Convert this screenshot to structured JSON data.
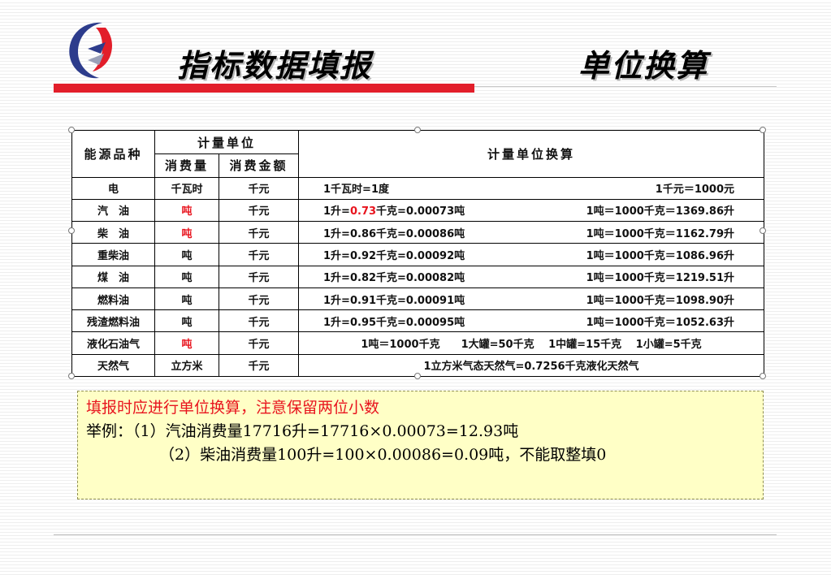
{
  "slide": {
    "title_left": "指标数据填报",
    "title_right": "单位换算",
    "accent_color": "#e21e2a"
  },
  "table": {
    "header": {
      "col_energy": "能源品种",
      "col_unit_group": "计量单位",
      "col_consumption": "消费量",
      "col_amount": "消费金额",
      "col_conversion": "计量单位换算"
    },
    "rows": [
      {
        "energy": "电",
        "consumption_unit": "千瓦时",
        "consumption_red": false,
        "amount_unit": "千元",
        "conv_a": "1千瓦时=1度",
        "conv_b": "1千元＝1000元"
      },
      {
        "energy": "汽　油",
        "consumption_unit": "吨",
        "consumption_red": true,
        "amount_unit": "千元",
        "conv_a_prefix": "1升=",
        "conv_a_highlight": "0.73",
        "conv_a_suffix": "千克=0.00073吨",
        "conv_b": "1吨＝1000千克＝1369.86升"
      },
      {
        "energy": "柴　油",
        "consumption_unit": "吨",
        "consumption_red": true,
        "amount_unit": "千元",
        "conv_a": "1升=0.86千克=0.00086吨",
        "conv_b": "1吨＝1000千克＝1162.79升"
      },
      {
        "energy": "重柴油",
        "consumption_unit": "吨",
        "consumption_red": false,
        "amount_unit": "千元",
        "conv_a": "1升=0.92千克=0.00092吨",
        "conv_b": "1吨＝1000千克＝1086.96升"
      },
      {
        "energy": "煤　油",
        "consumption_unit": "吨",
        "consumption_red": false,
        "amount_unit": "千元",
        "conv_a": "1升=0.82千克=0.00082吨",
        "conv_b": "1吨＝1000千克＝1219.51升"
      },
      {
        "energy": "燃料油",
        "consumption_unit": "吨",
        "consumption_red": false,
        "amount_unit": "千元",
        "conv_a": "1升=0.91千克=0.00091吨",
        "conv_b": "1吨＝1000千克＝1098.90升"
      },
      {
        "energy": "残渣燃料油",
        "consumption_unit": "吨",
        "consumption_red": false,
        "amount_unit": "千元",
        "conv_a": "1升=0.95千克=0.00095吨",
        "conv_b": "1吨＝1000千克＝1052.63升"
      },
      {
        "energy": "液化石油气",
        "consumption_unit": "吨",
        "consumption_red": true,
        "amount_unit": "千元",
        "conv_full": "1吨＝1000千克　　1大罐=50千克　 1中罐=15千克　 1小罐=5千克"
      },
      {
        "energy": "天然气",
        "consumption_unit": "立方米",
        "consumption_red": false,
        "amount_unit": "千元",
        "conv_full": "1立方米气态天然气=0.7256千克液化天然气"
      }
    ]
  },
  "note": {
    "line1": "填报时应进行单位换算，注意保留两位小数",
    "line2": "举例：（1）汽油消费量17716升=17716×0.00073=12.93吨",
    "line3": "（2）柴油消费量100升=100×0.00086=0.09吨，不能取整填0",
    "highlight_color": "#e8141e"
  }
}
